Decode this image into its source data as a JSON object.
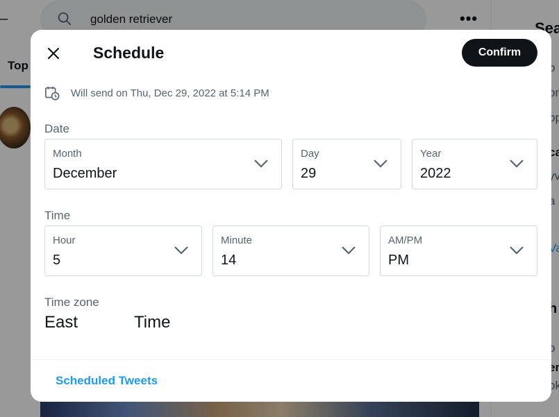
{
  "background": {
    "search_query": "golden retriever",
    "tab_label": "Top",
    "right_title": "Sea",
    "right_fragments": [
      "o",
      "on",
      "op",
      "ca",
      "yv",
      "a",
      "Va",
      "h",
      "o",
      "er",
      "ok"
    ]
  },
  "modal": {
    "title": "Schedule",
    "confirm_label": "Confirm",
    "send_info": "Will send on Thu, Dec 29, 2022 at 5:14 PM",
    "date_label": "Date",
    "time_label": "Time",
    "timezone_label": "Time zone",
    "timezone_words": [
      "East",
      "Time"
    ],
    "footer_link": "Scheduled Tweets",
    "date_fields": {
      "month": {
        "label": "Month",
        "value": "December"
      },
      "day": {
        "label": "Day",
        "value": "29"
      },
      "year": {
        "label": "Year",
        "value": "2022"
      }
    },
    "time_fields": {
      "hour": {
        "label": "Hour",
        "value": "5"
      },
      "minute": {
        "label": "Minute",
        "value": "14"
      },
      "ampm": {
        "label": "AM/PM",
        "value": "PM"
      }
    }
  },
  "colors": {
    "accent": "#1d9bf0",
    "primary_button": "#0f1419",
    "secondary_text": "#536471",
    "border": "#cfd9de"
  },
  "icons": [
    "search-icon",
    "more-icon",
    "close-icon",
    "calendar-clock-icon",
    "chevron-down-icon"
  ]
}
